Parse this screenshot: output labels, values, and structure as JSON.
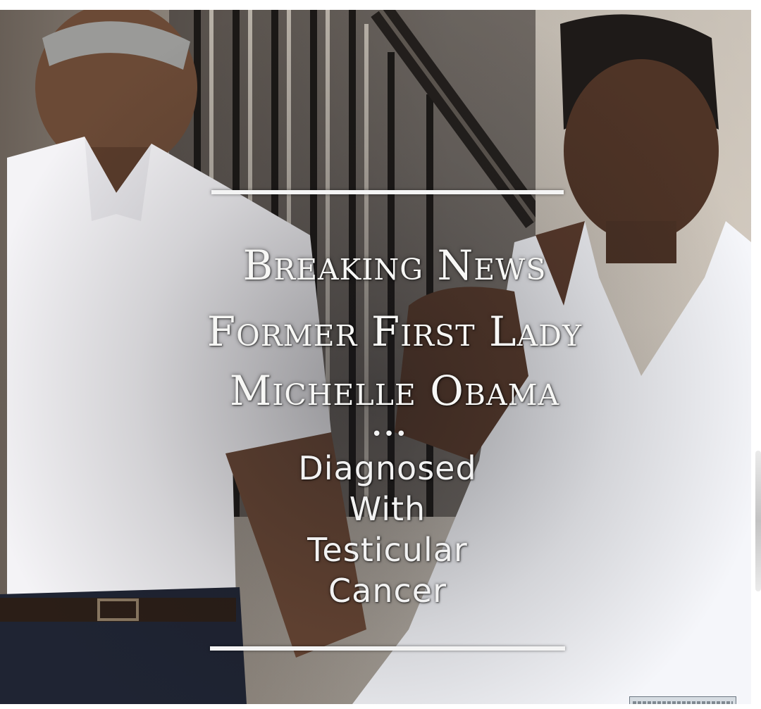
{
  "headline": {
    "line1": "Breaking News",
    "line2": "Former First Lady",
    "line3": "Michelle Obama"
  },
  "separator": "•••",
  "subtext": {
    "line1": "Diagnosed",
    "line2": "With",
    "line3": "Testicular",
    "line4": "Cancer"
  },
  "colors": {
    "text": "#f7f7f5",
    "rules": "#f4f4f4",
    "background": "#ffffff"
  }
}
